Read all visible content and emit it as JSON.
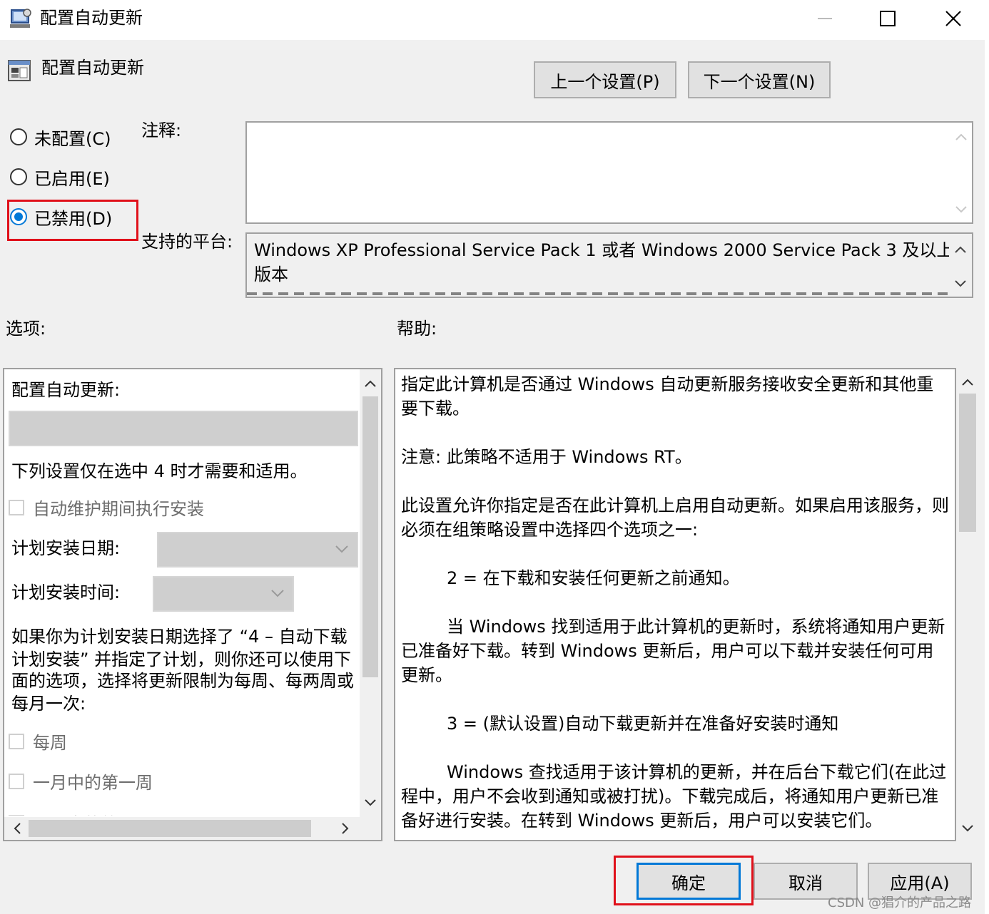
{
  "window": {
    "title": "配置自动更新",
    "controls": {
      "minimize": "minimize",
      "maximize": "maximize",
      "close": "close"
    }
  },
  "header": {
    "policy_title": "配置自动更新",
    "prev_button": "上一个设置(P)",
    "next_button": "下一个设置(N)"
  },
  "state": {
    "options": [
      {
        "label": "未配置(C)",
        "checked": false
      },
      {
        "label": "已启用(E)",
        "checked": false
      },
      {
        "label": "已禁用(D)",
        "checked": true
      }
    ]
  },
  "comment": {
    "label": "注释:",
    "value": ""
  },
  "platform": {
    "label": "支持的平台:",
    "line1": "Windows XP Professional Service Pack 1 或者 Windows 2000 Service Pack 3 及以上",
    "line2": "版本"
  },
  "options_panel": {
    "heading": "选项:",
    "title": "配置自动更新:",
    "note": "下列设置仅在选中 4 时才需要和适用。",
    "checkbox_maintenance": "自动维护期间执行安装",
    "schedule_day_label": "计划安装日期:",
    "schedule_time_label": "计划安装时间:",
    "para_line1": "如果你为计划安装日期选择了 “4 – 自动下载",
    "para_line2": "计划安装” 并指定了计划，则你还可以使用下",
    "para_line3": "面的选项，选择将更新限制为每周、每两周或",
    "para_line4": "每月一次:",
    "checkbox_weekly": "每周",
    "checkbox_first_week": "一月中的第一周",
    "checkbox_partial": "一月中的第二周"
  },
  "help_panel": {
    "heading": "帮助:",
    "p1_l1": "指定此计算机是否通过 Windows 自动更新服务接收安全更新和其他重",
    "p1_l2": "要下载。",
    "p2": "注意: 此策略不适用于 Windows RT。",
    "p3_l1": "此设置允许你指定是否在此计算机上启用自动更新。如果启用该服务，则",
    "p3_l2": "必须在组策略设置中选择四个选项之一:",
    "p4": "2 = 在下载和安装任何更新之前通知。",
    "p5_l1": "当 Windows 找到适用于此计算机的更新时，系统将通知用户更新",
    "p5_l2": "已准备好下载。转到 Windows 更新后，用户可以下载并安装任何可用",
    "p5_l3": "更新。",
    "p6": "3 = (默认设置)自动下载更新并在准备好安装时通知",
    "p7_l1": "Windows 查找适用于该计算机的更新，并在后台下载它们(在此过",
    "p7_l2": "程中，用户不会收到通知或被打扰)。下载完成后，将通知用户更新已准",
    "p7_l3": "备好进行安装。在转到 Windows 更新后，用户可以安装它们。"
  },
  "footer": {
    "ok": "确定",
    "cancel": "取消",
    "apply": "应用(A)"
  },
  "watermark": "CSDN @猖介的产品之路",
  "colors": {
    "highlight": "#e0101a",
    "radio_accent": "#0078d7"
  }
}
